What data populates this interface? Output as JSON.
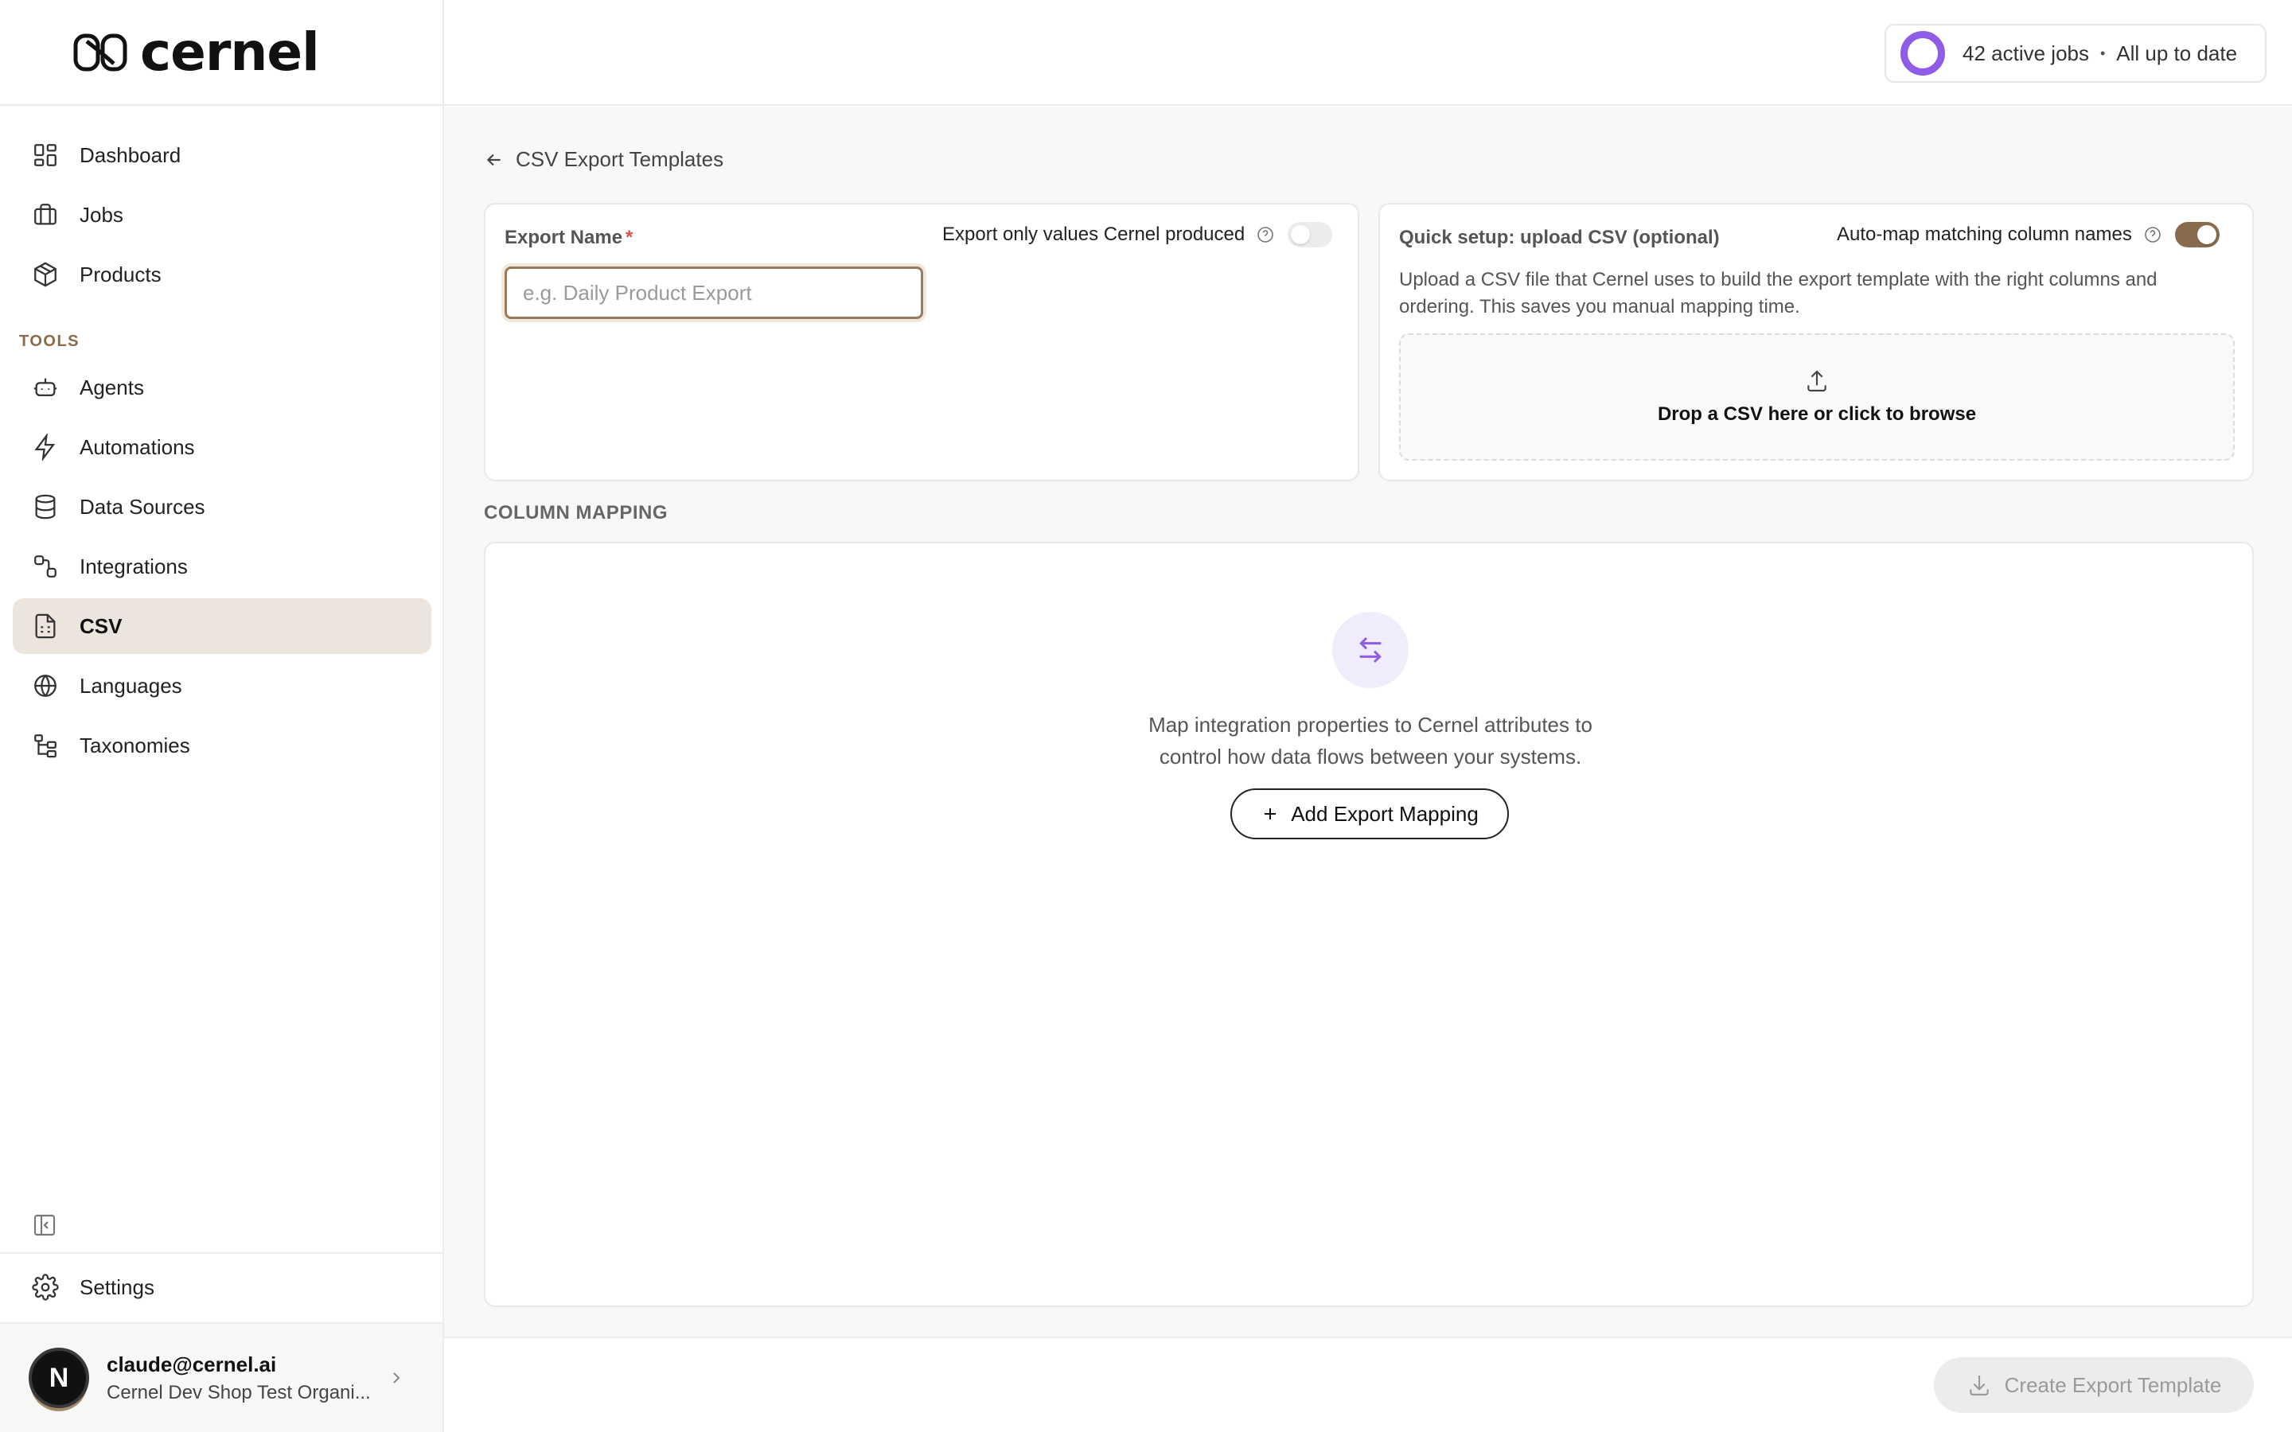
{
  "app": {
    "logo_text": "cernel"
  },
  "sidebar": {
    "items": [
      {
        "label": "Dashboard",
        "icon": "dashboard-icon"
      },
      {
        "label": "Jobs",
        "icon": "briefcase-icon"
      },
      {
        "label": "Products",
        "icon": "package-icon"
      }
    ],
    "tools_label": "TOOLS",
    "tools": [
      {
        "label": "Agents",
        "icon": "bot-icon"
      },
      {
        "label": "Automations",
        "icon": "lightning-icon"
      },
      {
        "label": "Data Sources",
        "icon": "database-icon"
      },
      {
        "label": "Integrations",
        "icon": "integrations-icon"
      },
      {
        "label": "CSV",
        "icon": "csv-file-icon",
        "active": true
      },
      {
        "label": "Languages",
        "icon": "globe-icon"
      },
      {
        "label": "Taxonomies",
        "icon": "taxonomy-icon"
      }
    ],
    "settings_label": "Settings",
    "user": {
      "initial": "N",
      "email": "claude@cernel.ai",
      "org": "Cernel Dev Shop Test Organi..."
    }
  },
  "topbar": {
    "jobs_text": "42 active jobs",
    "separator": "•",
    "status_text": "All up to date",
    "accent_color": "#8e5ce6"
  },
  "main": {
    "back_label": "CSV Export Templates",
    "export_name": {
      "label": "Export Name",
      "required_mark": "*",
      "placeholder": "e.g. Daily Product Export",
      "value": ""
    },
    "export_only_toggle": {
      "label": "Export only values Cernel produced",
      "on": false
    },
    "quick_setup": {
      "title": "Quick setup: upload CSV (optional)",
      "automap_label": "Auto-map matching column names",
      "automap_on": true,
      "description": "Upload a CSV file that Cernel uses to build the export template with the right columns and ordering. This saves you manual mapping time.",
      "dropzone_text": "Drop a CSV here or click to browse"
    },
    "column_mapping": {
      "label": "COLUMN MAPPING",
      "empty_line1": "Map integration properties to Cernel attributes to",
      "empty_line2": "control how data flows between your systems.",
      "add_button": "Add Export Mapping"
    }
  },
  "footer": {
    "create_button": "Create Export Template",
    "disabled": true
  }
}
